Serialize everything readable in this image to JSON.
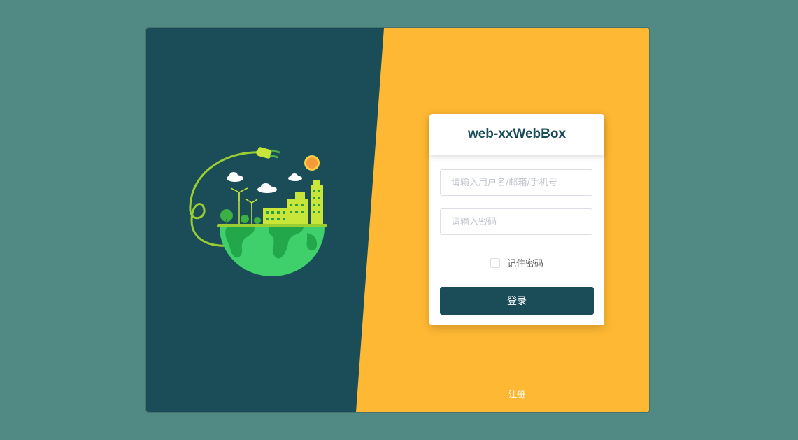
{
  "colors": {
    "page_background": "#518984",
    "left_panel": "#1A4D58",
    "right_panel": "#FEB833",
    "primary_button": "#1A4D58",
    "card_background": "#FFFFFF"
  },
  "illustration": {
    "icon": "eco-earth-plug-illustration"
  },
  "login_card": {
    "title": "web-xxWebBox",
    "username_placeholder": "请输入用户名/邮箱/手机号",
    "password_placeholder": "请输入密码",
    "remember_label": "记住密码",
    "remember_checked": false,
    "login_label": "登录"
  },
  "register_label": "注册"
}
